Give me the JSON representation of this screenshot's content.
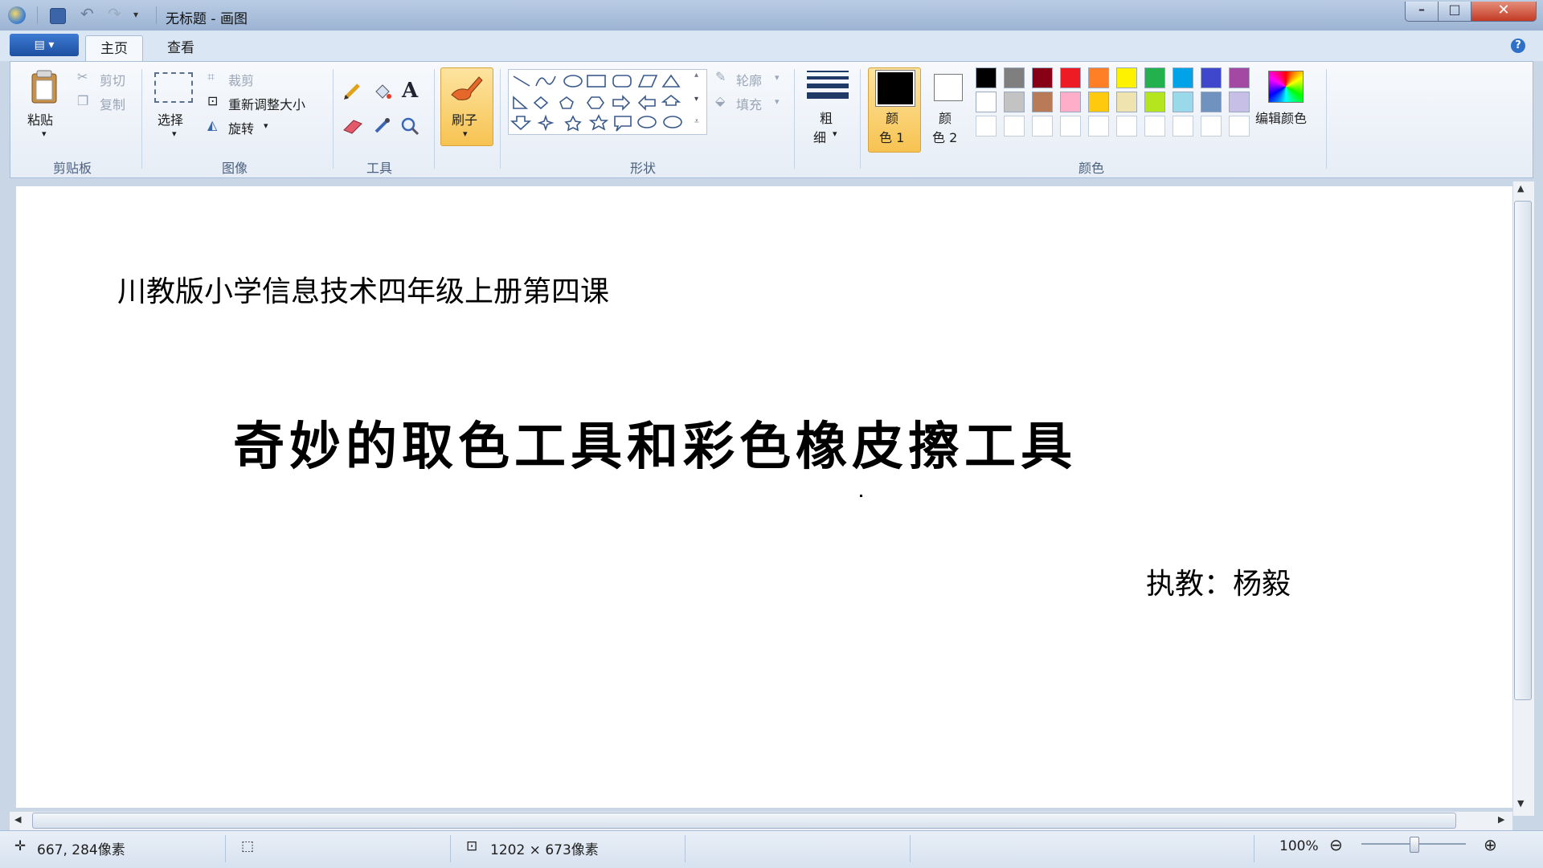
{
  "window": {
    "title": "无标题 - 画图",
    "controls": {
      "minimize": "–",
      "maximize": "□",
      "close": "✕"
    },
    "quick_access": {
      "menu_arrow": "▾"
    }
  },
  "tabs": {
    "app_menu": "▤ ▾",
    "home": "主页",
    "view": "查看",
    "help": "?"
  },
  "ribbon": {
    "clipboard": {
      "paste": "粘贴",
      "cut": "剪切",
      "copy": "复制",
      "label": "剪贴板"
    },
    "image": {
      "select": "选择",
      "crop": "裁剪",
      "resize": "重新调整大小",
      "rotate": "旋转",
      "label": "图像"
    },
    "tools": {
      "label": "工具"
    },
    "brushes": {
      "label": "刷子"
    },
    "shapes": {
      "outline": "轮廓",
      "fill": "填充",
      "label": "形状"
    },
    "size": {
      "label_top": "粗",
      "label_bottom": "细"
    },
    "colors": {
      "color1_top": "颜",
      "color1_bottom": "色 1",
      "color2_top": "颜",
      "color2_bottom": "色 2",
      "edit": "编辑颜色",
      "label": "颜色",
      "palette_row1": [
        "#000000",
        "#7f7f7f",
        "#880015",
        "#ed1c24",
        "#ff7f27",
        "#fff200",
        "#22b14c",
        "#00a2e8",
        "#3f48cc",
        "#a349a4"
      ],
      "palette_row2": [
        "#ffffff",
        "#c3c3c3",
        "#b97a57",
        "#ffaec9",
        "#ffc90e",
        "#efe4b0",
        "#b5e61d",
        "#99d9ea",
        "#7092be",
        "#c8bfe7"
      ],
      "palette_row3": [
        "#ffffff",
        "#ffffff",
        "#ffffff",
        "#ffffff",
        "#ffffff",
        "#ffffff",
        "#ffffff",
        "#ffffff",
        "#ffffff",
        "#ffffff"
      ]
    }
  },
  "canvas": {
    "subtitle": "川教版小学信息技术四年级上册第四课",
    "title": "奇妙的取色工具和彩色橡皮擦工具",
    "author": "执教：杨毅"
  },
  "status": {
    "cursor_position": "667, 284像素",
    "canvas_size": "1202 × 673像素",
    "zoom": "100%"
  }
}
